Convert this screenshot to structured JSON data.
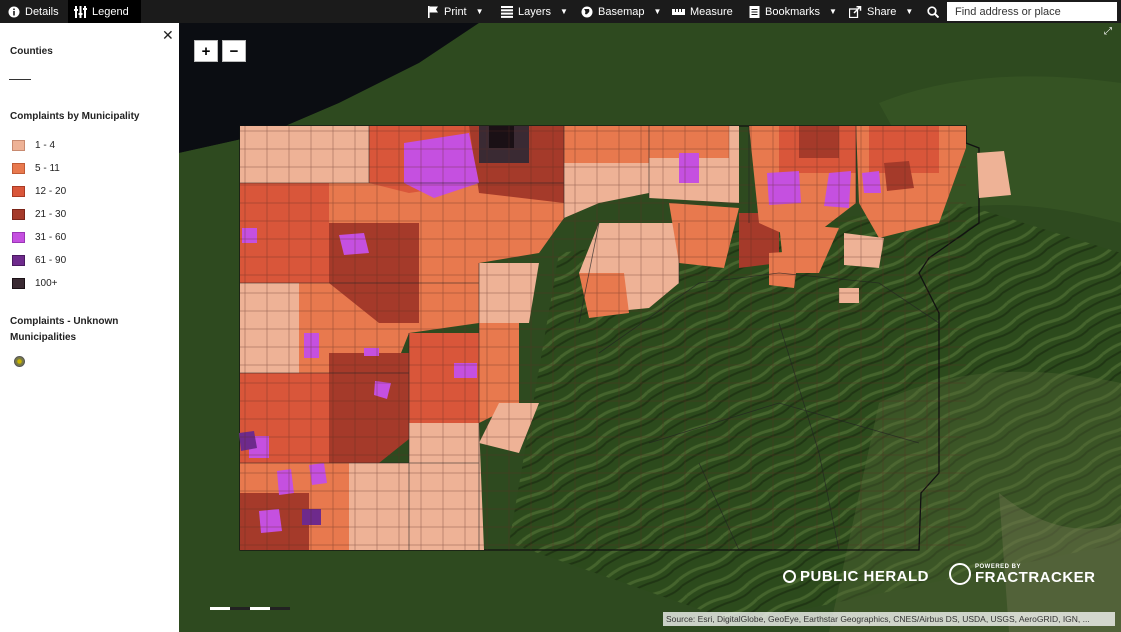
{
  "toolbar": {
    "details": "Details",
    "legend": "Legend",
    "print": "Print",
    "layers": "Layers",
    "basemap": "Basemap",
    "measure": "Measure",
    "bookmarks": "Bookmarks",
    "share": "Share",
    "search_placeholder": "Find address or place"
  },
  "legend": {
    "counties_title": "Counties",
    "complaints_title": "Complaints by Municipality",
    "classes": [
      {
        "label": "1 - 4",
        "color": "#eeb296"
      },
      {
        "label": "5 - 11",
        "color": "#e8794e"
      },
      {
        "label": "12 - 20",
        "color": "#d9563a"
      },
      {
        "label": "21 - 30",
        "color": "#a53a2a"
      },
      {
        "label": "31 - 60",
        "color": "#c550e0"
      },
      {
        "label": "61 - 90",
        "color": "#6e2a8c"
      },
      {
        "label": "100+",
        "color": "#3a2a33"
      }
    ],
    "unknown_title_line1": "Complaints - Unknown",
    "unknown_title_line2": "Municipalities"
  },
  "map": {
    "zoom_in": "+",
    "zoom_out": "−",
    "logo_public_herald": "PUBLIC HERALD",
    "logo_fractracker": "FRACTRACKER",
    "logo_powered_by": "POWERED BY",
    "attribution": "Source: Esri, DigitalGlobe, GeoEye, Earthstar Geographics, CNES/Airbus DS, USDA, USGS, AeroGRID, IGN, ..."
  }
}
